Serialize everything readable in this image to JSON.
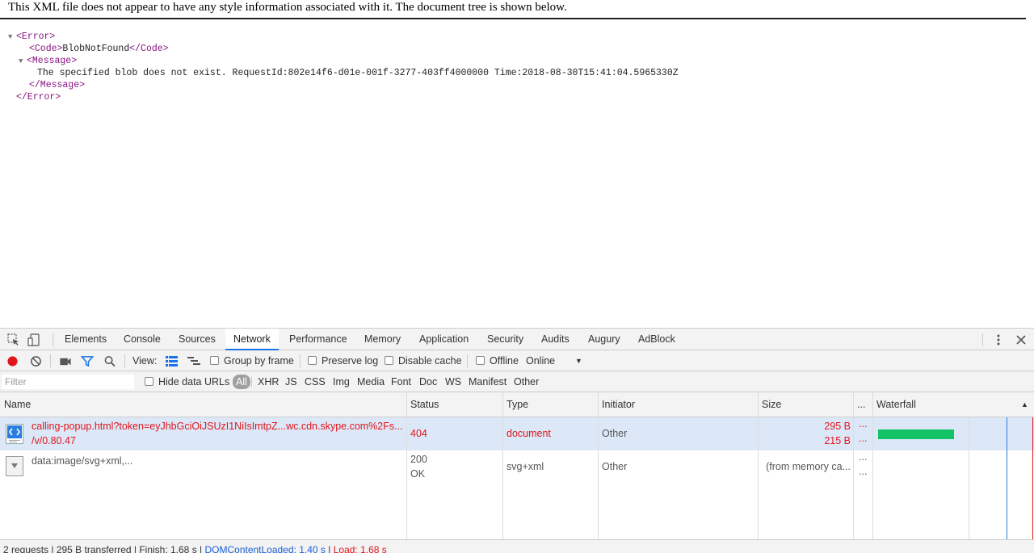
{
  "xml_page": {
    "notice": "This XML file does not appear to have any style information associated with it. The document tree is shown below.",
    "lines": {
      "error_open": "<Error>",
      "code_open": "<Code>",
      "code_value": "BlobNotFound",
      "code_close": "</Code>",
      "message_open": "<Message>",
      "message_value": "The specified blob does not exist. RequestId:802e14f6-d01e-001f-3277-403ff4000000 Time:2018-08-30T15:41:04.5965330Z",
      "message_close": "</Message>",
      "error_close": "</Error>"
    }
  },
  "devtools": {
    "tabs": [
      "Elements",
      "Console",
      "Sources",
      "Network",
      "Performance",
      "Memory",
      "Application",
      "Security",
      "Audits",
      "Augury",
      "AdBlock"
    ],
    "active_tab": "Network",
    "toolbar": {
      "view_label": "View:",
      "group_by_frame": "Group by frame",
      "preserve_log": "Preserve log",
      "disable_cache": "Disable cache",
      "offline": "Offline",
      "throttle": "Online"
    },
    "filter": {
      "placeholder": "Filter",
      "hide_data_urls": "Hide data URLs",
      "types": [
        "All",
        "XHR",
        "JS",
        "CSS",
        "Img",
        "Media",
        "Font",
        "Doc",
        "WS",
        "Manifest",
        "Other"
      ]
    },
    "columns": {
      "name": "Name",
      "status": "Status",
      "type": "Type",
      "initiator": "Initiator",
      "size": "Size",
      "more": "...",
      "waterfall": "Waterfall"
    },
    "requests": [
      {
        "name": "calling-popup.html?token=eyJhbGciOiJSUzI1NiIsImtpZ...wc.cdn.skype.com%2Fs...",
        "path": "/v/0.80.47",
        "status": "404",
        "status_text": "",
        "type": "document",
        "initiator": "Other",
        "size": "295 B",
        "size_content": "215 B",
        "dots": "...",
        "dots2": "..."
      },
      {
        "name": "data:image/svg+xml,...",
        "path": "",
        "status": "200",
        "status_text": "OK",
        "type": "svg+xml",
        "initiator": "Other",
        "size": "(from memory ca...",
        "size_content": "",
        "dots": "...",
        "dots2": "..."
      }
    ],
    "status_bar": {
      "summary": "2 requests | 295 B transferred | Finish: 1.68 s | ",
      "dom_content_loaded": "DOMContentLoaded: 1.40 s",
      "sep": " | ",
      "load": "Load: 1.68 s"
    },
    "colors": {
      "error_red": "#e0161b",
      "dcl_blue": "#1a5fd9",
      "waterfall_green": "#11c267",
      "record_red": "#e0161b",
      "active_blue": "#1a73e8"
    }
  }
}
